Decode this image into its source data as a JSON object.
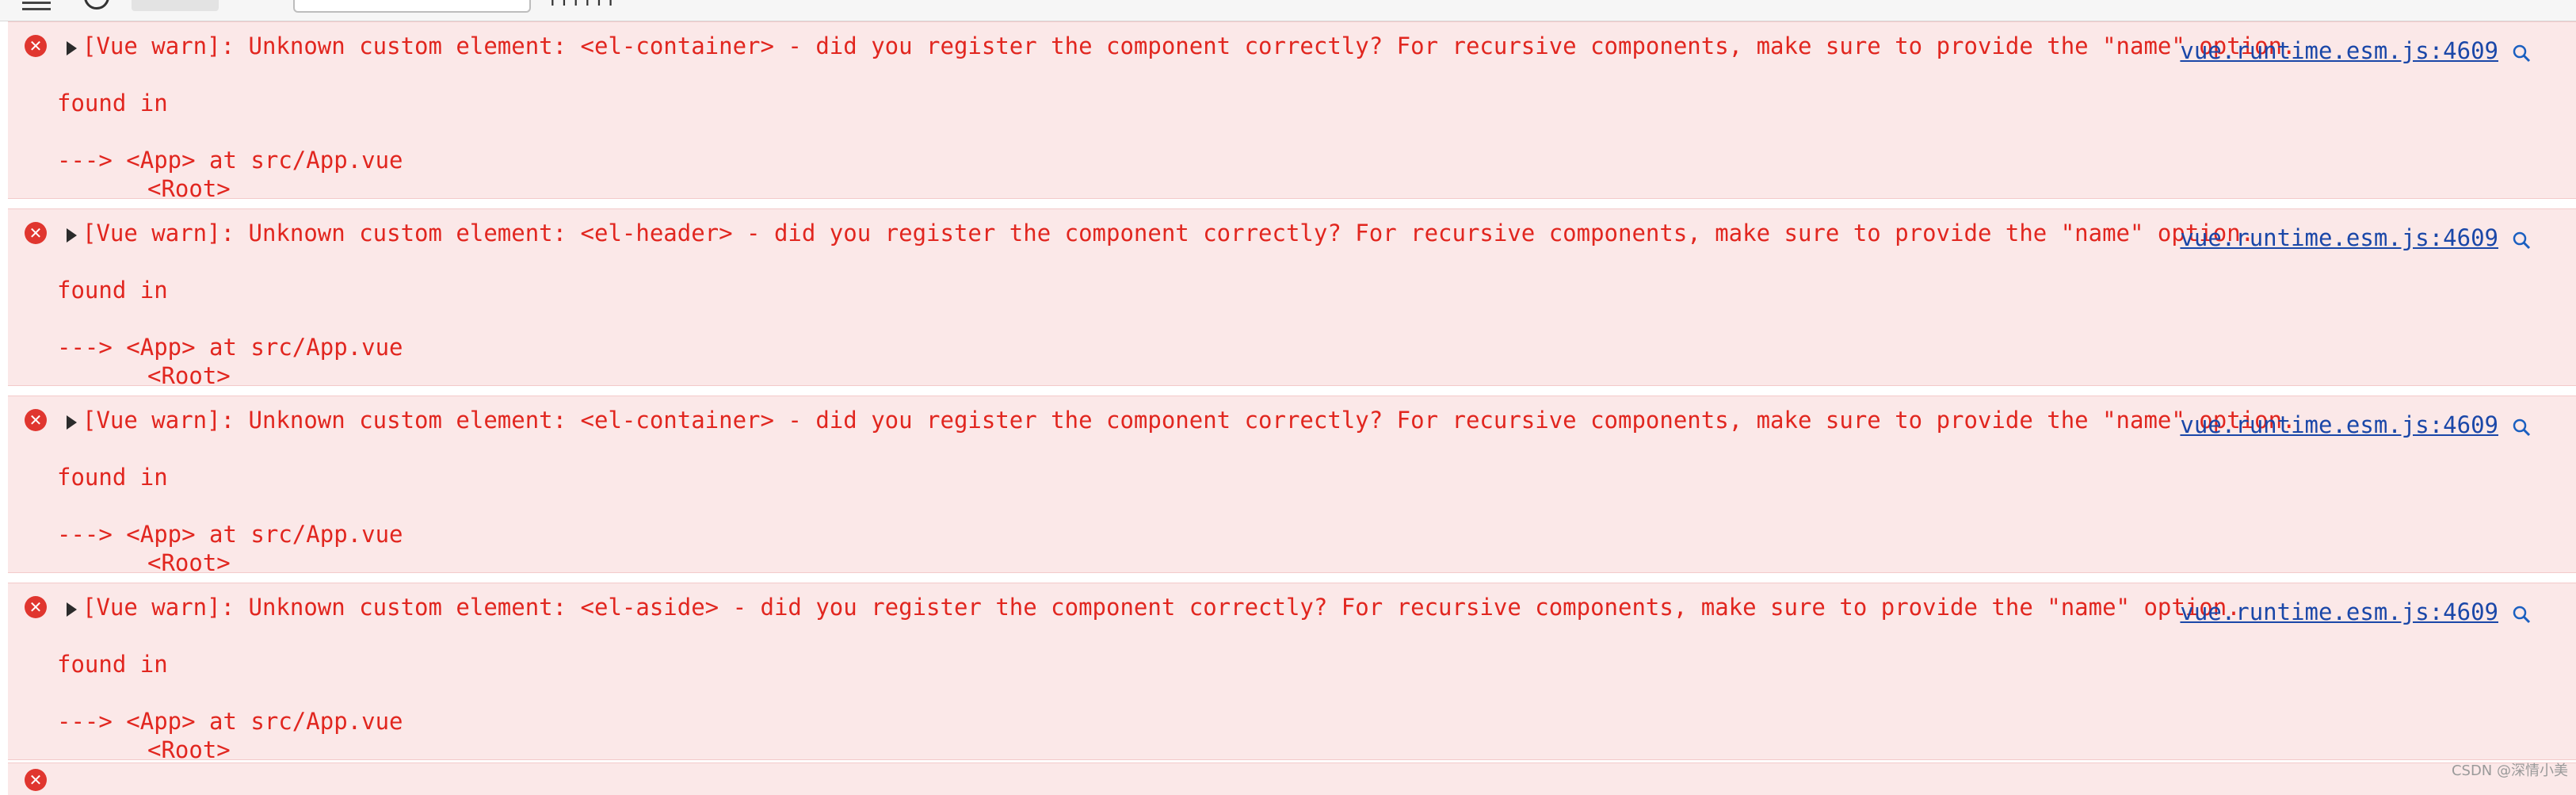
{
  "toolbar": {
    "label": "TTTTTT"
  },
  "messages": [
    {
      "text": "[Vue warn]: Unknown custom element: <el-container> - did you register the component correctly? For recursive components, make sure to provide the \"name\" option.",
      "found": "found in",
      "app": "---> <App> at src/App.vue",
      "root": "<Root>",
      "source": "vue.runtime.esm.js:4609"
    },
    {
      "text": "[Vue warn]: Unknown custom element: <el-header> - did you register the component correctly? For recursive components, make sure to provide the \"name\" option.",
      "found": "found in",
      "app": "---> <App> at src/App.vue",
      "root": "<Root>",
      "source": "vue.runtime.esm.js:4609"
    },
    {
      "text": "[Vue warn]: Unknown custom element: <el-container> - did you register the component correctly? For recursive components, make sure to provide the \"name\" option.",
      "found": "found in",
      "app": "---> <App> at src/App.vue",
      "root": "<Root>",
      "source": "vue.runtime.esm.js:4609"
    },
    {
      "text": "[Vue warn]: Unknown custom element: <el-aside> - did you register the component correctly? For recursive components, make sure to provide the \"name\" option.",
      "found": "found in",
      "app": "---> <App> at src/App.vue",
      "root": "<Root>",
      "source": "vue.runtime.esm.js:4609"
    }
  ],
  "icons": {
    "error": "error-icon",
    "expand": "expand-caret-icon",
    "reveal": "search-icon"
  },
  "colors": {
    "error_bg": "#fbe8e8",
    "error_text": "#e1261f",
    "link": "#1a47a8"
  },
  "watermark": "CSDN @深情小美"
}
